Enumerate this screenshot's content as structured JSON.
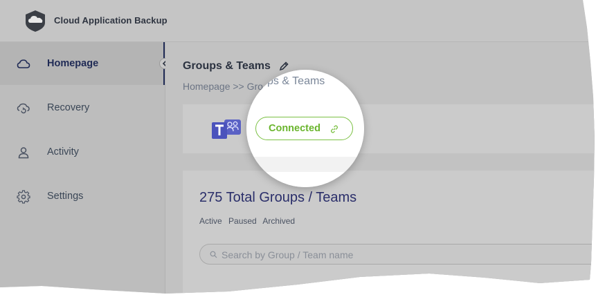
{
  "app": {
    "title": "Cloud Application Backup"
  },
  "sidebar": {
    "items": [
      {
        "label": "Homepage",
        "icon": "cloud-icon",
        "active": true
      },
      {
        "label": "Recovery",
        "icon": "cloud-restore-icon",
        "active": false
      },
      {
        "label": "Activity",
        "icon": "user-icon",
        "active": false
      },
      {
        "label": "Settings",
        "icon": "gear-icon",
        "active": false
      }
    ]
  },
  "main": {
    "title": "Groups & Teams",
    "breadcrumb": "Homepage >> Gro",
    "connection": {
      "status": "Connected",
      "color": "#6ab52d",
      "icon": "link-icon"
    },
    "total": "275 Total Groups / Teams",
    "filters": [
      "Active",
      "Paused",
      "Archived"
    ],
    "search": {
      "placeholder": "Search by Group / Team name"
    }
  },
  "magnifier": {
    "breadcrumb": "ps & Teams"
  },
  "colors": {
    "accent": "#1f2a55",
    "connected": "#6ab52d",
    "teams_purple": "#4b53bc"
  }
}
